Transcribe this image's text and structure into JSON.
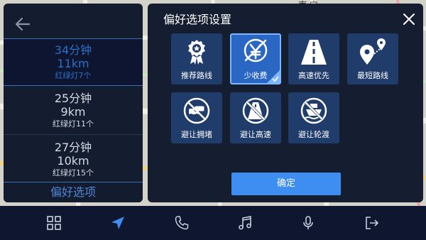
{
  "map": {
    "label": "南 宁"
  },
  "routes": [
    {
      "time": "34分钟",
      "distance": "11km",
      "lights": "红绿灯7个",
      "selected": true
    },
    {
      "time": "25分钟",
      "distance": "9km",
      "lights": "红绿灯11个",
      "selected": false
    },
    {
      "time": "27分钟",
      "distance": "10km",
      "lights": "红绿灯15个",
      "selected": false
    }
  ],
  "route_panel": {
    "preference_tab": "偏好选项"
  },
  "settings": {
    "title": "偏好选项设置",
    "options": [
      {
        "label": "推荐路线",
        "icon": "recommended-route-icon",
        "active": false
      },
      {
        "label": "少收费",
        "icon": "less-toll-icon",
        "active": true
      },
      {
        "label": "高速优先",
        "icon": "highway-priority-icon",
        "active": false
      },
      {
        "label": "最短路线",
        "icon": "shortest-route-icon",
        "active": false
      },
      {
        "label": "避让拥堵",
        "icon": "avoid-congestion-icon",
        "active": false
      },
      {
        "label": "避让高速",
        "icon": "avoid-highway-icon",
        "active": false
      },
      {
        "label": "避让轮渡",
        "icon": "avoid-ferry-icon",
        "active": false
      }
    ],
    "confirm_label": "确定"
  },
  "dock": [
    {
      "icon": "apps-grid-icon",
      "active": false
    },
    {
      "icon": "navigation-icon",
      "active": true
    },
    {
      "icon": "phone-icon",
      "active": false
    },
    {
      "icon": "music-icon",
      "active": false
    },
    {
      "icon": "microphone-icon",
      "active": false
    },
    {
      "icon": "exit-icon",
      "active": false
    }
  ],
  "colors": {
    "accent": "#3d8ef0",
    "panel": "#151d30",
    "tile": "#1f3c6b",
    "tile_active": "#2a66c4"
  }
}
